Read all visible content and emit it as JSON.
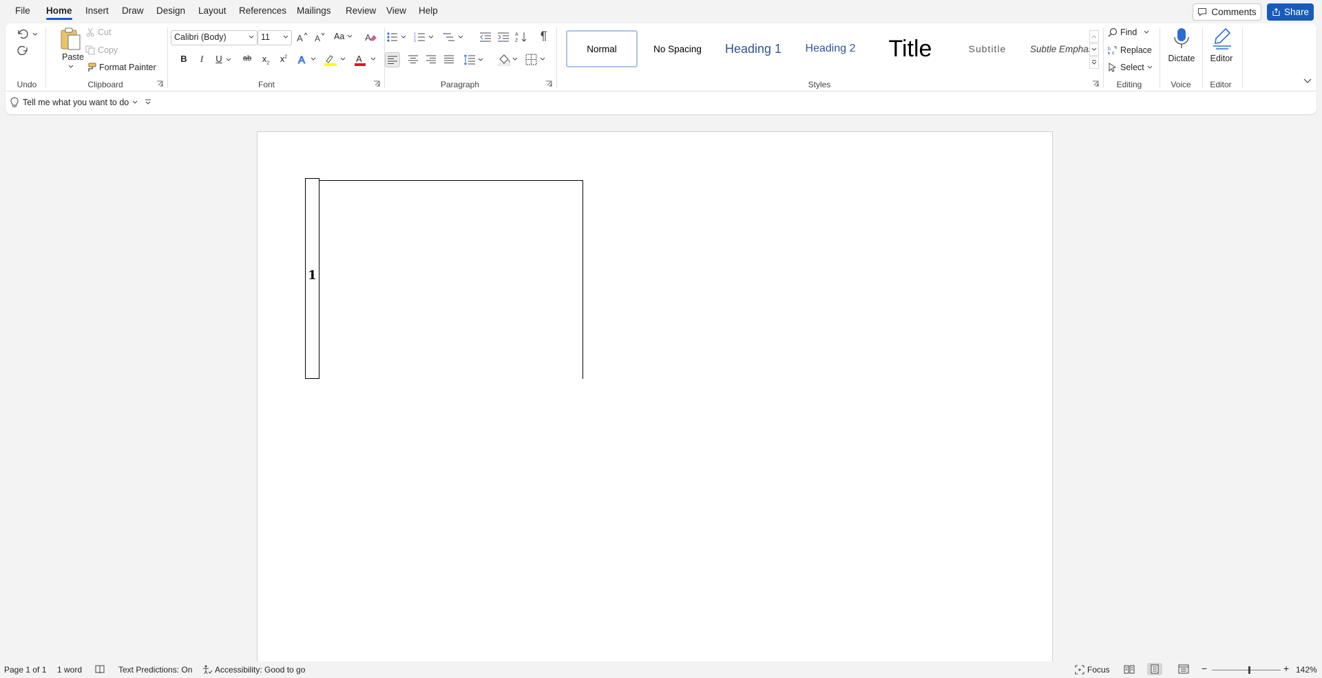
{
  "menu": {
    "tabs": [
      "File",
      "Home",
      "Insert",
      "Draw",
      "Design",
      "Layout",
      "References",
      "Mailings",
      "Review",
      "View",
      "Help"
    ],
    "active_tab": "Home",
    "comments_label": "Comments",
    "share_label": "Share"
  },
  "ribbon": {
    "undo": {
      "label": "Undo"
    },
    "clipboard": {
      "label": "Clipboard",
      "paste": "Paste",
      "cut": "Cut",
      "copy": "Copy",
      "format_painter": "Format Painter"
    },
    "font": {
      "label": "Font",
      "font_name": "Calibri (Body)",
      "font_size": "11",
      "change_case": "Aa",
      "bold": "B",
      "italic": "I",
      "underline": "U",
      "strikethrough": "ab",
      "subscript": "x",
      "superscript": "x"
    },
    "paragraph": {
      "label": "Paragraph"
    },
    "styles": {
      "label": "Styles",
      "items": [
        "Normal",
        "No Spacing",
        "Heading 1",
        "Heading 2",
        "Title",
        "Subtitle",
        "Subtle Emphasis"
      ],
      "selected": "Normal"
    },
    "editing": {
      "label": "Editing",
      "find": "Find",
      "replace": "Replace",
      "select": "Select"
    },
    "voice": {
      "label": "Voice",
      "dictate": "Dictate"
    },
    "editor": {
      "label": "Editor",
      "editor": "Editor"
    }
  },
  "tellme": {
    "placeholder": "Tell me what you want to do"
  },
  "document": {
    "box_label": "1"
  },
  "status": {
    "page": "Page 1 of 1",
    "words": "1 word",
    "text_predictions": "Text Predictions: On",
    "accessibility": "Accessibility: Good to go",
    "focus": "Focus",
    "zoom": "142%"
  },
  "colors": {
    "accent": "#185abd",
    "highlight": "#ffff00",
    "font_color": "#e81123"
  }
}
